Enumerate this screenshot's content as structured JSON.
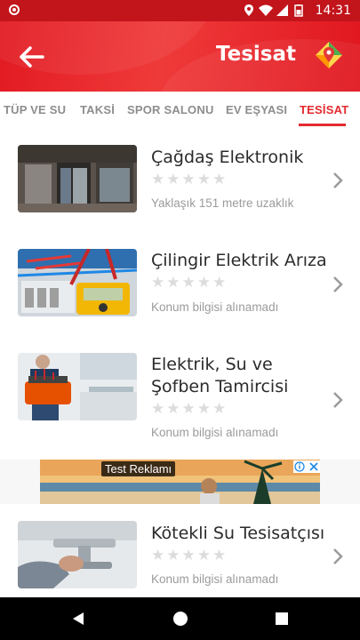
{
  "status_bar": {
    "time": "14:31",
    "icons": [
      "location-icon",
      "wifi-icon",
      "signal-icon",
      "battery-icon"
    ]
  },
  "app_bar": {
    "title": "Tesisat",
    "back_icon": "arrow-left-icon",
    "map_icon": "map-pin-icon"
  },
  "tabs": [
    {
      "label": "TÜP VE SU",
      "active": false
    },
    {
      "label": "TAKSİ",
      "active": false
    },
    {
      "label": "SPOR SALONU",
      "active": false
    },
    {
      "label": "EV EŞYASI",
      "active": false
    },
    {
      "label": "TESİSAT",
      "active": true
    }
  ],
  "items": [
    {
      "name": "Çağdaş Elektronik",
      "distance": "Yaklaşık 151 metre uzaklık",
      "rating": 0
    },
    {
      "name": "Çilingir Elektrik Arıza",
      "distance": "Konum bilgisi alınamadı",
      "rating": 0
    },
    {
      "name": "Elektrik, Su ve Şofben Tamircisi",
      "distance": "Konum bilgisi alınamadı",
      "rating": 0
    },
    {
      "name": "Kötekli Su Tesisatçısı",
      "distance": "Konum bilgisi alınamadı",
      "rating": 0
    }
  ],
  "ad": {
    "label": "Test Reklamı"
  },
  "colors": {
    "primary": "#e21a22",
    "accent_tab": "#e32a2f",
    "text_dark": "#2b2b2b",
    "text_muted": "#9b9b9b"
  }
}
